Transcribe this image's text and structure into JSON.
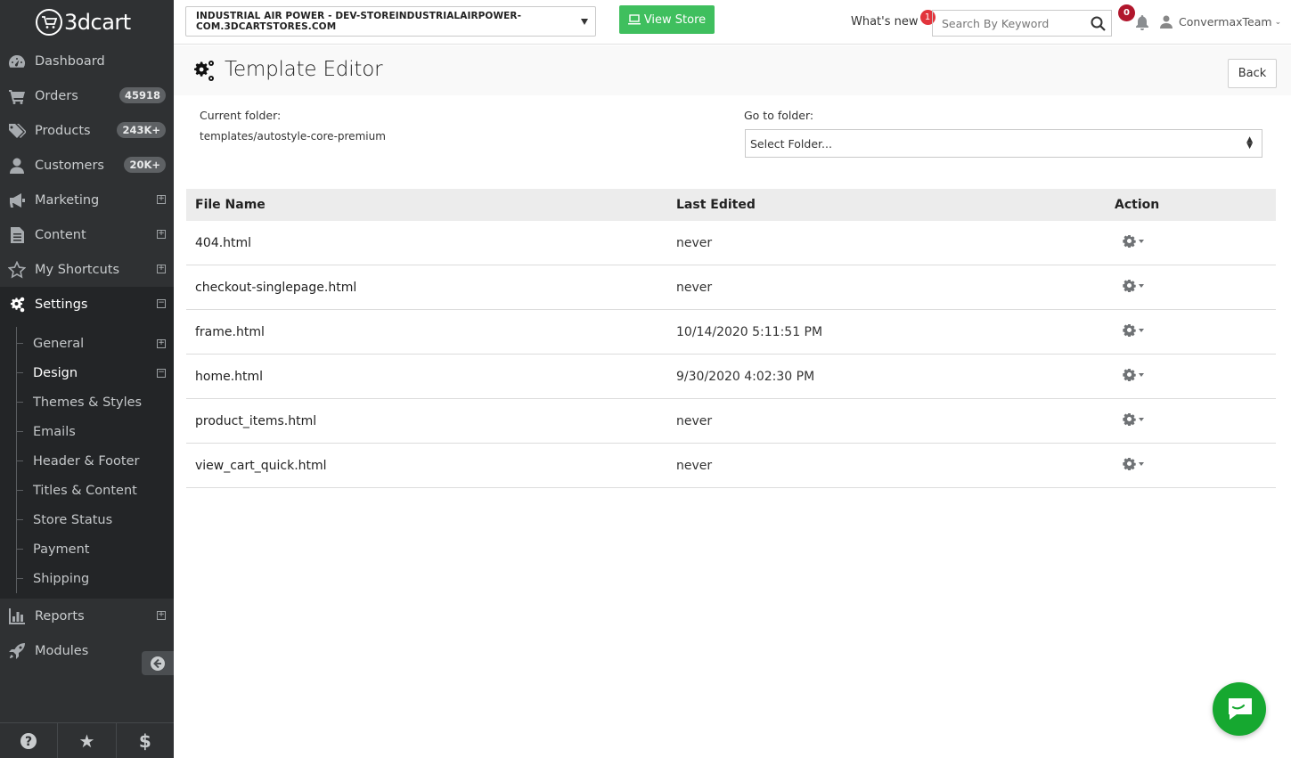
{
  "brand": {
    "logo_text": "3dcart"
  },
  "sidebar": {
    "items": [
      {
        "label": "Dashboard",
        "icon": "dashboard-icon"
      },
      {
        "label": "Orders",
        "icon": "cart-icon",
        "badge": "45918"
      },
      {
        "label": "Products",
        "icon": "tags-icon",
        "badge": "243K+"
      },
      {
        "label": "Customers",
        "icon": "user-icon",
        "badge": "20K+"
      },
      {
        "label": "Marketing",
        "icon": "megaphone-icon",
        "expand": "⊞"
      },
      {
        "label": "Content",
        "icon": "document-icon",
        "expand": "⊞"
      },
      {
        "label": "My Shortcuts",
        "icon": "star-icon",
        "expand": "⊞"
      },
      {
        "label": "Settings",
        "icon": "gears-icon",
        "expand": "⊟"
      }
    ],
    "subitems": [
      {
        "label": "General",
        "expand": "+"
      },
      {
        "label": "Design",
        "expand": "−"
      },
      {
        "label": "Themes & Styles"
      },
      {
        "label": "Emails"
      },
      {
        "label": "Header & Footer"
      },
      {
        "label": "Titles & Content"
      },
      {
        "label": "Store Status"
      },
      {
        "label": "Payment"
      },
      {
        "label": "Shipping"
      }
    ],
    "bottom_items": [
      {
        "label": "Reports",
        "icon": "bar-chart-icon",
        "expand": "+"
      },
      {
        "label": "Modules",
        "icon": "rocket-icon"
      }
    ],
    "footer": {
      "help": "?",
      "favorites": "★",
      "billing": "$"
    }
  },
  "topbar": {
    "store_name": "INDUSTRIAL AIR POWER - DEV-STOREINDUSTRIALAIRPOWER-COM.3DCARTSTORES.COM",
    "view_store": "View Store",
    "whats_new": "What's new",
    "whats_new_count": "1",
    "search_placeholder": "Search By Keyword",
    "notifications_count": "0",
    "user_name": "ConvermaxTeam"
  },
  "page": {
    "title": "Template Editor",
    "back": "Back",
    "current_folder_label": "Current folder:",
    "current_folder_value": "templates/autostyle-core-premium",
    "goto_folder_label": "Go to folder:",
    "goto_folder_placeholder": "Select Folder..."
  },
  "table": {
    "headers": {
      "file_name": "File Name",
      "last_edited": "Last Edited",
      "action": "Action"
    },
    "rows": [
      {
        "file": "404.html",
        "edited": "never"
      },
      {
        "file": "checkout-singlepage.html",
        "edited": "never"
      },
      {
        "file": "frame.html",
        "edited": "10/14/2020 5:11:51 PM"
      },
      {
        "file": "home.html",
        "edited": "9/30/2020 4:02:30 PM"
      },
      {
        "file": "product_items.html",
        "edited": "never"
      },
      {
        "file": "view_cart_quick.html",
        "edited": "never"
      }
    ]
  },
  "colors": {
    "sidebar_bg": "#2f3133",
    "view_store_green": "#3fbf5e",
    "chat_green": "#16a830",
    "alert_red": "#e2343c"
  }
}
